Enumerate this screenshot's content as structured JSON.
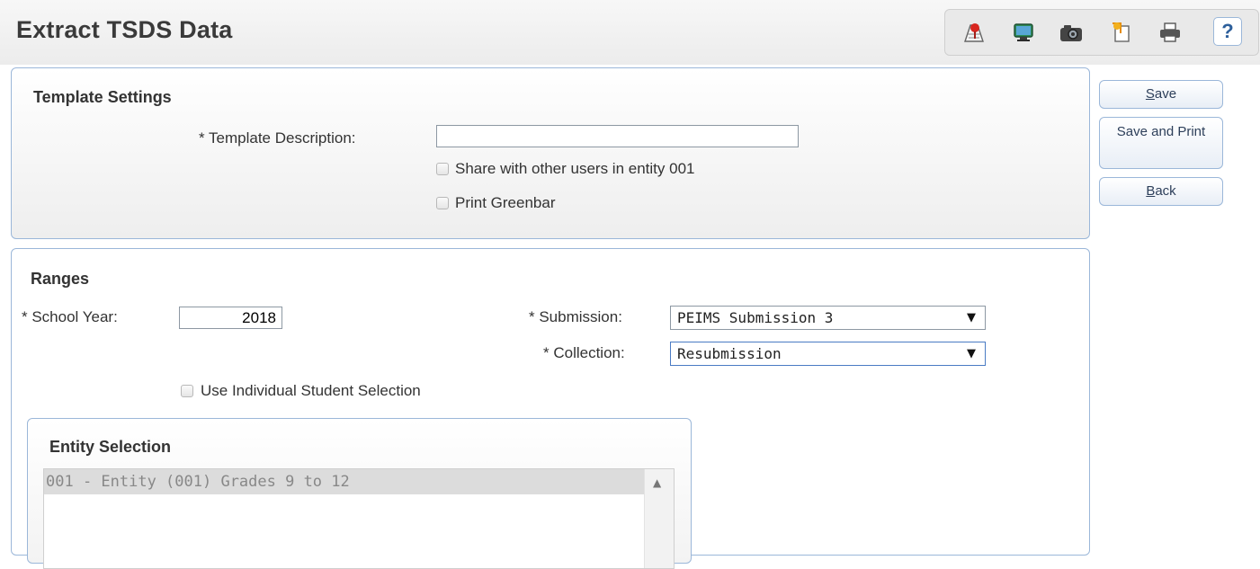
{
  "header": {
    "title": "Extract TSDS Data",
    "help_label": "?"
  },
  "toolbar": {
    "icons": [
      "map-marker-icon",
      "monitor-icon",
      "camera-icon",
      "clipboard-icon",
      "printer-icon",
      "help-icon"
    ]
  },
  "template_settings": {
    "title": "Template Settings",
    "description_label": "* Template Description:",
    "description_value": "",
    "share_label": "Share with other users in entity 001",
    "share_checked": false,
    "greenbar_label": "Print Greenbar",
    "greenbar_checked": false
  },
  "actions": {
    "save_prefix": "S",
    "save_suffix": "ave",
    "save_print_label": "Save and Print",
    "back_prefix": "B",
    "back_suffix": "ack"
  },
  "ranges": {
    "title": "Ranges",
    "school_year_label": "* School Year:",
    "school_year_value": "2018",
    "submission_label": "* Submission:",
    "submission_value": "PEIMS Submission 3",
    "collection_label": "* Collection:",
    "collection_value": "Resubmission",
    "use_individual_label": "Use Individual Student Selection",
    "use_individual_checked": false
  },
  "entity_selection": {
    "title": "Entity Selection",
    "items": [
      "001 - Entity (001) Grades 9 to 12"
    ]
  }
}
